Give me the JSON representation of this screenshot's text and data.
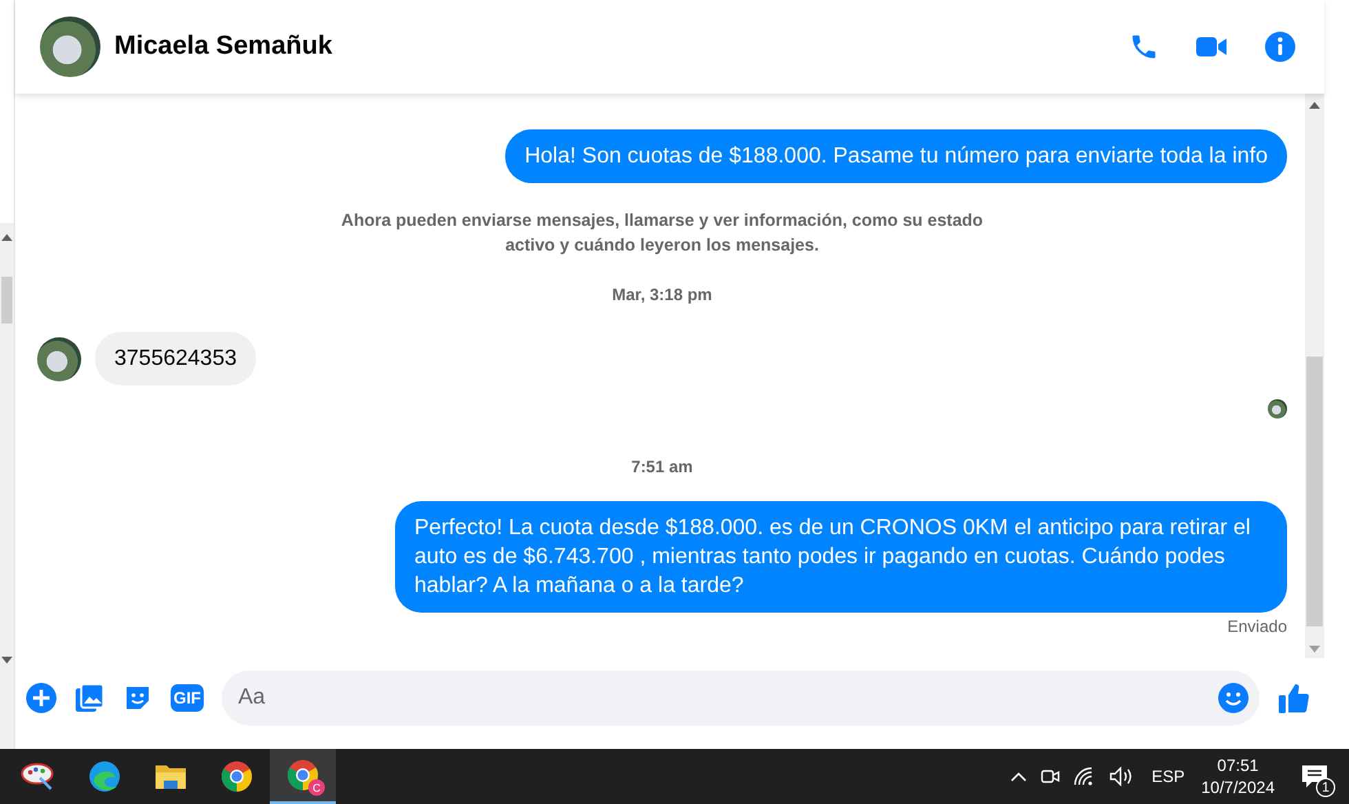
{
  "header": {
    "contact_name": "Micaela Semañuk"
  },
  "messages": [
    {
      "kind": "outgoing",
      "text": "Hola! Son cuotas de $188.000. Pasame tu número para enviarte toda la info"
    },
    {
      "kind": "system",
      "text": "Ahora pueden enviarse mensajes, llamarse y ver información, como su estado activo y cuándo leyeron los mensajes."
    },
    {
      "kind": "timestamp",
      "text": "Mar, 3:18 pm"
    },
    {
      "kind": "incoming",
      "text": "3755624353"
    },
    {
      "kind": "seen"
    },
    {
      "kind": "timestamp",
      "text": "7:51 am"
    },
    {
      "kind": "outgoing",
      "text": "Perfecto! La cuota desde $188.000. es de un CRONOS 0KM el anticipo para retirar el auto es de $6.743.700 , mientras tanto podes ir pagando en cuotas. Cuándo podes hablar? A la mañana o a la tarde?"
    },
    {
      "kind": "status",
      "text": "Enviado"
    }
  ],
  "composer": {
    "gif_label": "GIF",
    "placeholder": "Aa"
  },
  "taskbar": {
    "apps": [
      {
        "kind": "paint",
        "selected": false
      },
      {
        "kind": "edge",
        "selected": false
      },
      {
        "kind": "folder",
        "selected": false
      },
      {
        "kind": "chrome",
        "selected": false
      },
      {
        "kind": "chrome-profile",
        "selected": true,
        "badge": "C"
      }
    ],
    "language": "ESP",
    "time": "07:51",
    "date": "10/7/2024",
    "notification_count": "1"
  }
}
